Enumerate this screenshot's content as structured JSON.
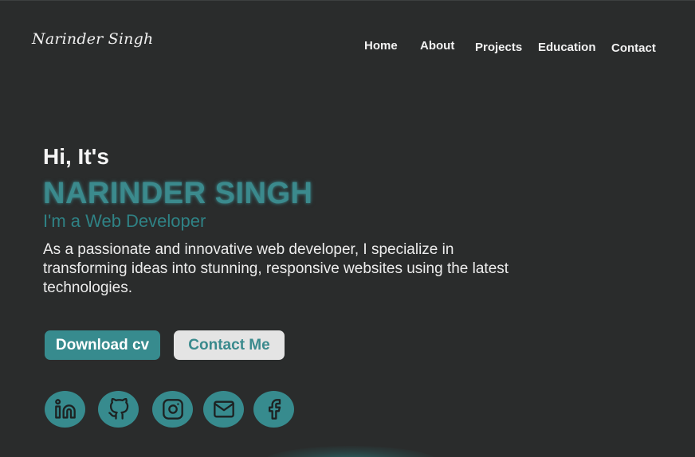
{
  "brand": {
    "logo_text": "Narinder Singh"
  },
  "nav": {
    "items": [
      {
        "label": "Home"
      },
      {
        "label": "About"
      },
      {
        "label": "Projects"
      },
      {
        "label": "Education"
      },
      {
        "label": "Contact"
      }
    ]
  },
  "hero": {
    "greeting": "Hi, It's",
    "name": "NARINDER SINGH",
    "role": "I'm a Web Developer",
    "description": "As a passionate and innovative web developer, I specialize in transforming ideas into stunning, responsive websites using the latest technologies."
  },
  "buttons": {
    "download_label": "Download cv",
    "contact_label": "Contact Me"
  },
  "social": [
    "linkedin-icon",
    "github-icon",
    "instagram-icon",
    "mail-icon",
    "facebook-icon"
  ],
  "colors": {
    "background": "#2a2c2c",
    "accent": "#378b8e",
    "text": "#f2f2f2",
    "button_light": "#e4e4e4"
  }
}
